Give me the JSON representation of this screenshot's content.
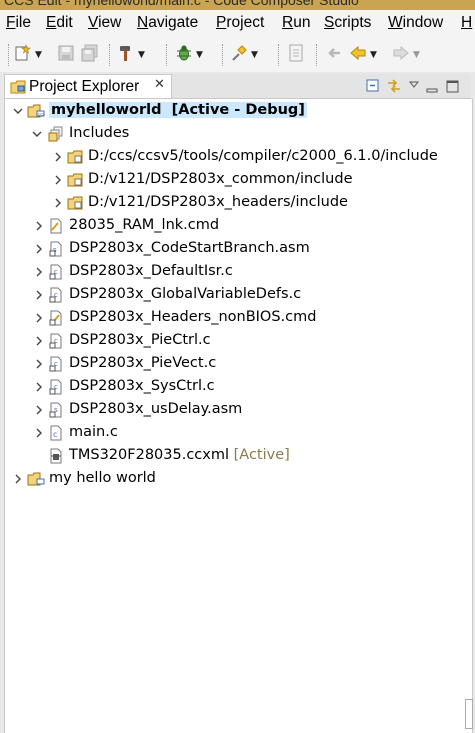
{
  "window": {
    "title": "CCS Edit - myhelloworld/main.c - Code Composer Studio"
  },
  "menubar": {
    "items": [
      {
        "label": "File",
        "mnemonic": "F",
        "rest": "ile"
      },
      {
        "label": "Edit",
        "mnemonic": "E",
        "rest": "dit"
      },
      {
        "label": "View",
        "mnemonic": "V",
        "rest": "iew"
      },
      {
        "label": "Navigate",
        "mnemonic": "N",
        "rest": "avigate"
      },
      {
        "label": "Project",
        "mnemonic": "P",
        "rest": "roject"
      },
      {
        "label": "Run",
        "mnemonic": "R",
        "rest": "un"
      },
      {
        "label": "Scripts",
        "mnemonic": "S",
        "rest": "cripts"
      },
      {
        "label": "Window",
        "mnemonic": "W",
        "rest": "indow"
      },
      {
        "label": "Help",
        "mnemonic": "H",
        "rest": ""
      }
    ]
  },
  "toolbar": {
    "icons": [
      "new-icon",
      "save-icon",
      "save-all-icon",
      "build-hammer-icon",
      "debug-bug-icon",
      "tool-pin-icon",
      "console-icon",
      "last-edit-icon",
      "back-arrow-icon",
      "forward-arrow-icon"
    ]
  },
  "view": {
    "tab_label": "Project Explorer",
    "tab_close": "✕"
  },
  "tree": {
    "project": {
      "name": "myhelloworld",
      "tag": "[Active - Debug]"
    },
    "includes": {
      "label": "Includes",
      "items": [
        "D:/ccs/ccsv5/tools/compiler/c2000_6.1.0/include",
        "D:/v121/DSP2803x_common/include",
        "D:/v121/DSP2803x_headers/include"
      ]
    },
    "files": [
      {
        "name": "28035_RAM_lnk.cmd",
        "kind": "cmd"
      },
      {
        "name": "DSP2803x_CodeStartBranch.asm",
        "kind": "asm"
      },
      {
        "name": "DSP2803x_DefaultIsr.c",
        "kind": "c-link"
      },
      {
        "name": "DSP2803x_GlobalVariableDefs.c",
        "kind": "c-link"
      },
      {
        "name": "DSP2803x_Headers_nonBIOS.cmd",
        "kind": "cmd-link"
      },
      {
        "name": "DSP2803x_PieCtrl.c",
        "kind": "c-link"
      },
      {
        "name": "DSP2803x_PieVect.c",
        "kind": "c-link"
      },
      {
        "name": "DSP2803x_SysCtrl.c",
        "kind": "c-link"
      },
      {
        "name": "DSP2803x_usDelay.asm",
        "kind": "asm-link"
      },
      {
        "name": "main.c",
        "kind": "c"
      }
    ],
    "ccxml": {
      "name": "TMS320F28035.ccxml",
      "tag": "[Active]"
    },
    "other_project": {
      "name": "my hello world"
    }
  },
  "colors": {
    "selection": "#cce8ff",
    "active_tag": "#8b7a4a",
    "title_bar": "#c9a451"
  }
}
